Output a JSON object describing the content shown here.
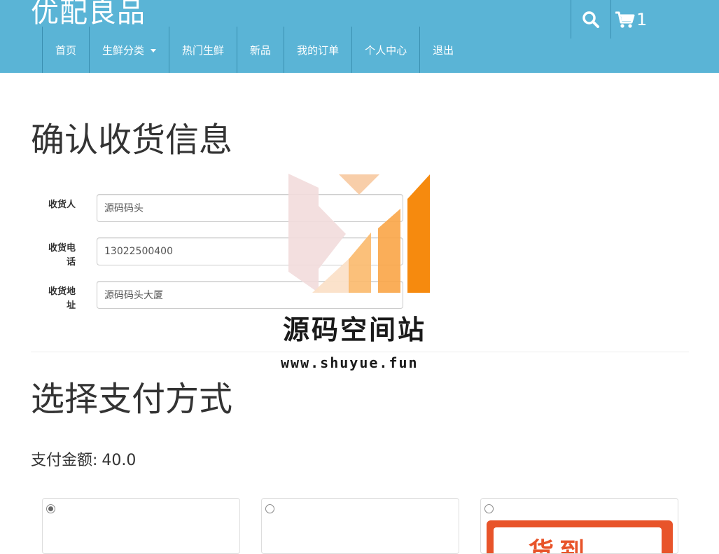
{
  "header": {
    "brand": "优配良品",
    "nav": [
      {
        "label": "首页"
      },
      {
        "label": "生鲜分类"
      },
      {
        "label": "热门生鲜"
      },
      {
        "label": "新品"
      },
      {
        "label": "我的订单"
      },
      {
        "label": "个人中心"
      },
      {
        "label": "退出"
      }
    ],
    "cart_count": "1",
    "icons": [
      "search-icon",
      "cart-icon",
      "chevron-down-icon"
    ]
  },
  "shipping": {
    "title": "确认收货信息",
    "fields": [
      {
        "label": "收货人",
        "value": "源码码头"
      },
      {
        "label": "收货电话",
        "value": "13022500400"
      },
      {
        "label": "收货地址",
        "value": "源码码头大厦"
      }
    ]
  },
  "payment": {
    "title": "选择支付方式",
    "amount_label": "支付金额:",
    "amount": "40.0",
    "options": [
      {
        "selected": true
      },
      {
        "selected": false
      },
      {
        "selected": false,
        "logo_text": "货到"
      }
    ]
  },
  "watermark": {
    "name": "源码空间站",
    "url": "www.shuyue.fun"
  },
  "colors": {
    "header_bg": "#5ab4d6",
    "header_text": "#ffffff",
    "logo_orange": "#e8542a",
    "watermark_orange": "#f68a0e"
  }
}
